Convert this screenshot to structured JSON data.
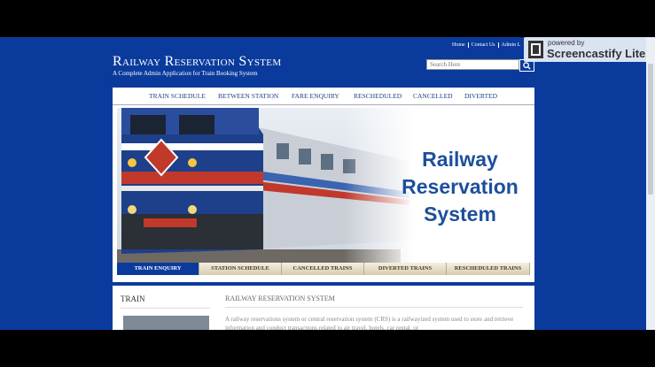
{
  "top_links": [
    "Home",
    "Contact Us",
    "Admin L"
  ],
  "watermark": {
    "small": "powered by",
    "big": "Screencastify Lite"
  },
  "site": {
    "title": "Railway Reservation System",
    "subtitle": "A Complete Admin Application for Train Booking System"
  },
  "search": {
    "placeholder": "Search Here"
  },
  "menu": [
    "TRAIN SCHEDULE",
    "BETWEEN STATION",
    "FARE ENQUIRY",
    "RESCHEDULED",
    "CANCELLED",
    "DIVERTED"
  ],
  "banner": {
    "text_lines": [
      "Railway",
      "Reservation",
      "System"
    ]
  },
  "tabs": [
    "TRAIN ENQUIRY",
    "STATION SCHEDULE",
    "CANCELLED TRAINS",
    "DIVERTED TRAINS",
    "RESCHEDULED TRAINS"
  ],
  "sidebar": {
    "title": "TRAIN"
  },
  "main": {
    "title": "RAILWAY RESERVATION SYSTEM",
    "paragraph": "A railway reservations system or central reservation system (CRS) is a railwayized system used to store and retrieve information and conduct transactions related to air travel, hotels, car rental, or"
  },
  "colors": {
    "page_bg": "#0a3b9c",
    "banner_text": "#1d4f9c",
    "active_tab": "#0a3b9c"
  }
}
